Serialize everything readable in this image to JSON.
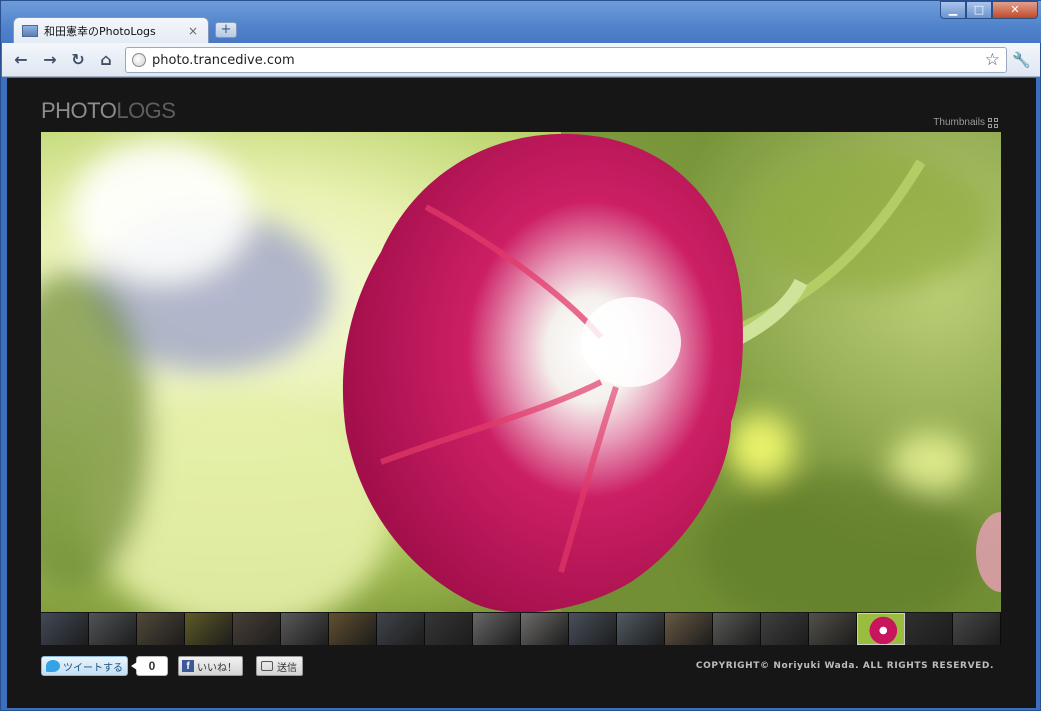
{
  "browser": {
    "tab_title": "和田憲幸のPhotoLogs",
    "tab_close": "×",
    "new_tab": "+",
    "window_buttons": {
      "minimize": "▁",
      "maximize": "□",
      "close": "✕"
    },
    "nav": {
      "back": "←",
      "forward": "→",
      "reload": "↻",
      "home": "⌂"
    },
    "url": "photo.trancedive.com",
    "bookmark_star": "☆",
    "settings": "🔧"
  },
  "page": {
    "logo_part1": "PHOTO",
    "logo_part2": "LOGS",
    "thumbnails_label": "Thumbnails",
    "thumbnail_count": 20,
    "active_thumbnail_index": 17
  },
  "social": {
    "tweet_label": "ツイートする",
    "tweet_count": "0",
    "like_label": "いいね！",
    "facebook_letter": "f",
    "send_label": "送信"
  },
  "footer": {
    "copyright": "COPYRIGHT© Noriyuki Wada. ALL RIGHTS RESERVED."
  },
  "colors": {
    "page_background": "#161616",
    "flower": "#c8155e",
    "foliage": "#9bbd3f"
  }
}
